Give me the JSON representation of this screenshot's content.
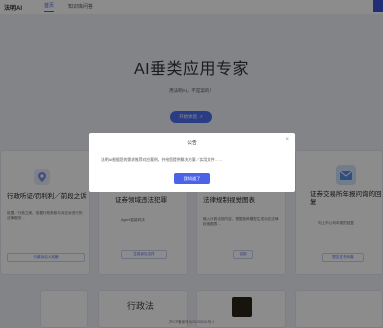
{
  "nav": {
    "brand": "法明AI",
    "tabs": [
      {
        "label": "首页",
        "active": true
      },
      {
        "label": "知识库问答",
        "active": false
      }
    ]
  },
  "hero": {
    "title": "AI垂类应用专家",
    "subtitle": "用法明AI，不是案的！",
    "button_label": "开始体验",
    "button_arrow": "↗"
  },
  "cards": [
    {
      "title": "行政听证/罚利利／前段之诉",
      "desc": "依据／行政立案、依据行政条款与对应诉进行的法律服务…",
      "button": "行政诉讼人判断",
      "icon": "location-pin-icon",
      "icon_color": "#e8ecfb"
    },
    {
      "title": "证券领域违法犯罪",
      "desc": "Agent智能判决",
      "button": "生成诉讼文件",
      "icon": "doc-icon",
      "icon_color": "#e8ecfb"
    },
    {
      "title": "法律规制视觉图表",
      "desc": "输入行政法规内容，根据各种模型生成对应法律检索图表…",
      "button": "试用",
      "icon": "chart-icon",
      "icon_color": "#e8ecfb"
    },
    {
      "title": "证券交易所年报问询的回复",
      "desc": "向上市公司年报的回复",
      "button": "提交文书问卷",
      "icon": "mail-icon",
      "icon_color": "#cfe3ff"
    }
  ],
  "bottom": {
    "card2_text": "行政法",
    "footer": "沪ICP备案号为20230001号-1"
  },
  "modal": {
    "title": "公告",
    "close": "×",
    "body": "法明AI根据您的需求推荐对应案例，并给您提供解决方案／实用文件……",
    "button": "我知道了"
  }
}
